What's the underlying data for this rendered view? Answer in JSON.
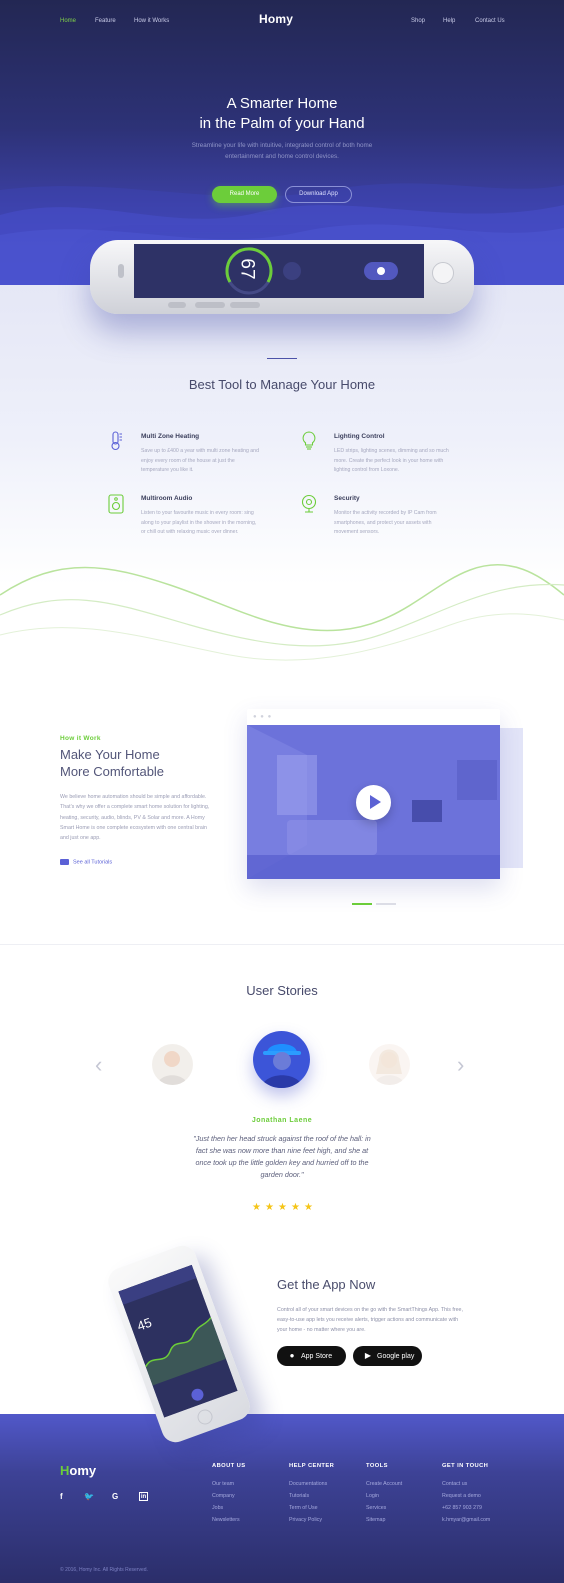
{
  "colors": {
    "accent_green": "#6ccd3a",
    "accent_purple": "#5b61d6",
    "star": "#f5c518"
  },
  "nav": {
    "left": [
      "Home",
      "Feature",
      "How it Works"
    ],
    "logo": "Homy",
    "right": [
      "Shop",
      "Help",
      "Contact Us"
    ]
  },
  "hero": {
    "title_line1": "A Smarter Home",
    "title_line2": "in the Palm of your Hand",
    "subtitle_line1": "Streamline your life with intuitive, integrated control of both home",
    "subtitle_line2": "entertainment and home control devices.",
    "primary_button": "Read More",
    "secondary_button": "Download App",
    "phone_temp": "67"
  },
  "features": {
    "title": "Best Tool to Manage Your Home",
    "items": [
      {
        "icon": "thermometer-icon",
        "title": "Multi Zone Heating",
        "text": "Save up to £400 a year with multi zone heating and enjoy every room of the house at just the temperature you like it."
      },
      {
        "icon": "lightbulb-icon",
        "title": "Lighting Control",
        "text": "LED strips, lighting scenes, dimming and so much more. Create the perfect look in your home with lighting control from Loxone."
      },
      {
        "icon": "speaker-icon",
        "title": "Multiroom Audio",
        "text": "Listen to your favourite music in every room: sing along to your playlist in the shower in the morning, or chill out with relaxing music over dinner."
      },
      {
        "icon": "webcam-icon",
        "title": "Security",
        "text": "Monitor the activity recorded by IP Cam from smartphones, and protect your assets with movement sensors."
      }
    ]
  },
  "how": {
    "tag": "How it Work",
    "title_line1": "Make Your Home",
    "title_line2": "More Comfortable",
    "text": "We believe home automation should be simple and affordable. That's why we offer a complete smart home solution for lighting, heating, security, audio, blinds, PV & Solar and more. A Homy Smart Home is one complete ecosystem with one central brain and just one app.",
    "link": "See all Tutorials"
  },
  "stories": {
    "title": "User Stories",
    "name": "Jonathan Laene",
    "quote": "\"Just then her head struck against the roof of the hall: in fact she was now more than nine feet high, and she at once took up the little golden key and hurried off to the garden door.\"",
    "rating": 5
  },
  "app": {
    "title": "Get the App Now",
    "text": "Control all of your smart devices on the go with the SmartThings App. This free, easy-to-use app lets you receive alerts, trigger actions and communicate with your home - no matter where you are.",
    "appstore": "App Store",
    "googleplay": "Google play",
    "phone_value": "45"
  },
  "footer": {
    "logo": "Homy",
    "cols": [
      {
        "title": "ABOUT US",
        "links": [
          "Our team",
          "Company",
          "Jobs",
          "Newsletters"
        ]
      },
      {
        "title": "HELP CENTER",
        "links": [
          "Documentations",
          "Tutorials",
          "Term of Use",
          "Privacy Policy"
        ]
      },
      {
        "title": "TOOLS",
        "links": [
          "Create Account",
          "Login",
          "Services",
          "Sitemap"
        ]
      },
      {
        "title": "GET IN TOUCH",
        "links": [
          "Contact us",
          "Request a demo",
          "+62 857 903 279",
          "k.hmyar@gmail.com"
        ]
      }
    ],
    "copyright": "© 2016, Homy Inc. All Rights Reserved."
  }
}
